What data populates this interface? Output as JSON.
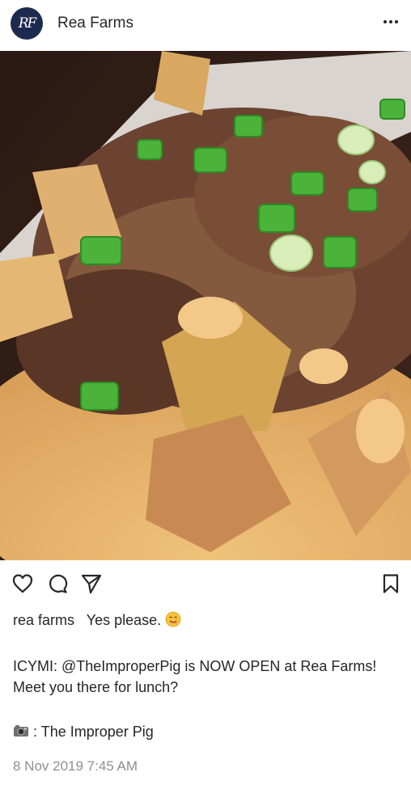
{
  "header": {
    "avatar_monogram": "RF",
    "account_name": "Rea Farms",
    "more_icon": "more-dots-icon"
  },
  "photo": {
    "description_icon": "food-photo"
  },
  "actions": {
    "like_icon": "heart-icon",
    "comment_icon": "comment-icon",
    "share_icon": "share-icon",
    "save_icon": "bookmark-icon"
  },
  "caption": {
    "username": "rea farms",
    "text": "Yes please.",
    "emoji": "yum-face-emoji"
  },
  "body": {
    "line1": "ICYMI: @TheImproperPig is NOW OPEN at Rea Farms!",
    "line2": "Meet you there for lunch?"
  },
  "credit": {
    "camera_icon": "camera-icon",
    "text": ": The Improper Pig"
  },
  "timestamp": "8 Nov 2019 7:45 AM",
  "colors": {
    "avatar_bg": "#1d2a4f",
    "text": "#262626",
    "muted": "#8e8e8e"
  }
}
